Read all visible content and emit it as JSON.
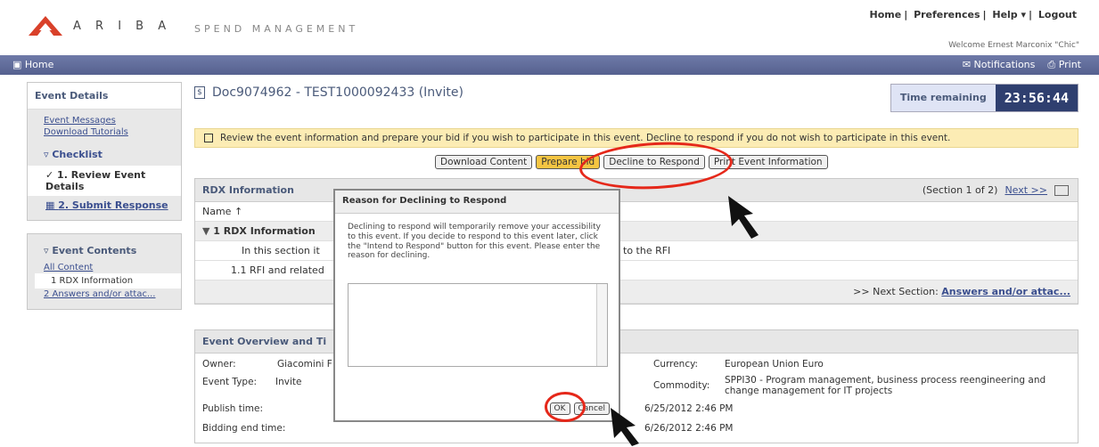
{
  "header": {
    "brand": "A R I B A",
    "tagline": "SPEND MANAGEMENT",
    "links": [
      "Home",
      "Preferences",
      "Help ▾",
      "Logout"
    ],
    "welcome": "Welcome Ernest Marconix \"Chic\""
  },
  "nav": {
    "home": "Home",
    "notifications": "Notifications",
    "print": "Print"
  },
  "sidebar": {
    "title": "Event Details",
    "links": [
      "Event Messages",
      "Download Tutorials"
    ],
    "checklist_title": "Checklist",
    "steps": [
      "1. Review Event Details",
      "2. Submit Response"
    ],
    "contents_title": "Event Contents",
    "content_links": [
      "All Content",
      "1 RDX Information",
      "2 Answers and/or attac..."
    ]
  },
  "main": {
    "doc_title": "Doc9074962 - TEST1000092433 (Invite)",
    "time_label": "Time remaining",
    "time_value": "23:56:44",
    "notice": "Review the event information and prepare your bid if you wish to participate in this event.  Decline to respond if you do not wish to participate in this event.",
    "buttons": [
      "Download Content",
      "Prepare bid",
      "Decline to Respond",
      "Print Event Information"
    ],
    "panel_title": "RDX Information",
    "section_info": "(Section 1 of 2)",
    "next_label": "Next >>",
    "name_col": "Name ↑",
    "row1": "1  RDX Information",
    "row2_left": "In this section it",
    "row2_right": "to the RFI",
    "row3": "1.1  RFI and related",
    "next_section_prefix": ">> Next Section:",
    "next_section_link": "Answers and/or attac...",
    "overview_title": "Event Overview and Ti",
    "owner_label": "Owner:",
    "owner_value": "Giacomini F",
    "event_type_label": "Event Type:",
    "event_type_value": "Invite",
    "publish_label": "Publish time:",
    "bidding_label": "Bidding end time:",
    "currency_label": "Currency:",
    "currency_value": "European Union Euro",
    "commodity_label": "Commodity:",
    "commodity_value": "SPPI30 - Program management, business process reengineering and change management for IT projects",
    "publish_value": "6/25/2012 2:46 PM",
    "bidding_value": "6/26/2012 2:46 PM"
  },
  "dialog": {
    "title": "Reason for Declining to Respond",
    "message": "Declining to respond will temporarily remove your accessibility to this event. If you decide to respond to this event later, click the \"Intend to Respond\" button for this event. Please enter the reason for declining.",
    "ok": "OK",
    "cancel": "Cancel"
  }
}
